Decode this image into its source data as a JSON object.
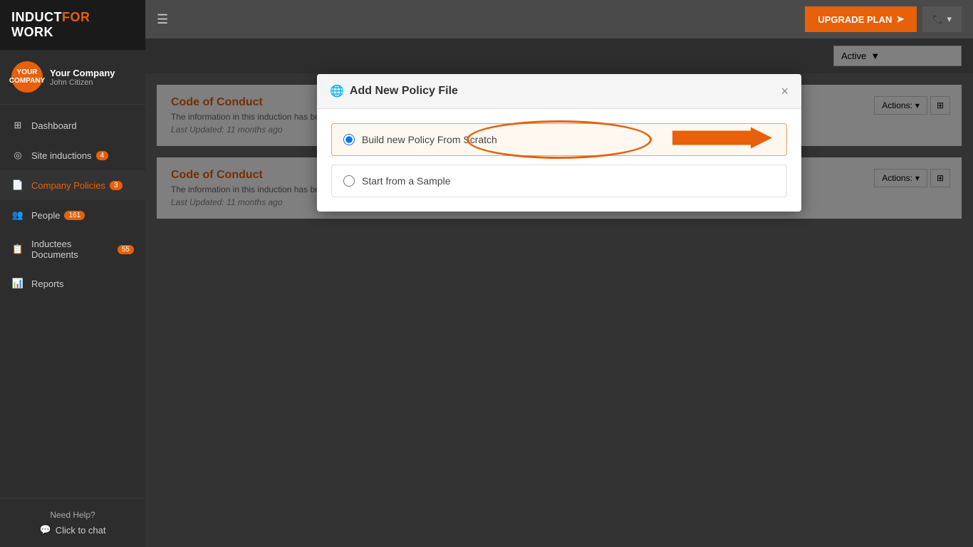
{
  "logo": {
    "induct": "INDUCT",
    "for": "FOR",
    "work": " WORK"
  },
  "profile": {
    "avatar_text": "YOUR\nCOMPANY",
    "company": "Your Company",
    "name": "John Citizen"
  },
  "nav": {
    "items": [
      {
        "id": "dashboard",
        "label": "Dashboard",
        "icon": "dashboard",
        "badge": null,
        "active": false
      },
      {
        "id": "site-inductions",
        "label": "Site inductions",
        "icon": "location",
        "badge": "4",
        "active": false
      },
      {
        "id": "company-policies",
        "label": "Company Policies",
        "icon": "policies",
        "badge": "3",
        "active": true
      },
      {
        "id": "people",
        "label": "People",
        "icon": "people",
        "badge": "161",
        "active": false
      },
      {
        "id": "inductees-documents",
        "label": "Inductees Documents",
        "icon": "documents",
        "badge": "55",
        "active": false
      },
      {
        "id": "reports",
        "label": "Reports",
        "icon": "reports",
        "badge": null,
        "active": false
      }
    ],
    "footer": {
      "need_help": "Need Help?",
      "click_chat": "Click to chat"
    }
  },
  "topbar": {
    "upgrade_plan": "UPGRADE PLAN",
    "phone_icon": "📞"
  },
  "filter": {
    "active_label": "Active",
    "dropdown_arrow": "▼"
  },
  "policies": [
    {
      "title": "Code of Conduct",
      "description": "The information in this induction has been based on \"HR manual template\" from http://www.business.vic.gov.au/",
      "last_updated_label": "Last Updated:",
      "last_updated_value": "11 months ago",
      "actions_label": "Actions:",
      "actions_arrow": "▾"
    },
    {
      "title": "Code of Conduct",
      "description": "The information in this induction has been based on \"HR manual template\" from http://www.business.vic.gov.au/",
      "last_updated_label": "Last Updated:",
      "last_updated_value": "11 months ago",
      "actions_label": "Actions:",
      "actions_arrow": "▾"
    }
  ],
  "modal": {
    "title": "Add New Policy File",
    "close_label": "×",
    "options": [
      {
        "id": "scratch",
        "label": "Build new Policy From Scratch",
        "selected": true
      },
      {
        "id": "sample",
        "label": "Start from a Sample",
        "selected": false
      }
    ]
  }
}
